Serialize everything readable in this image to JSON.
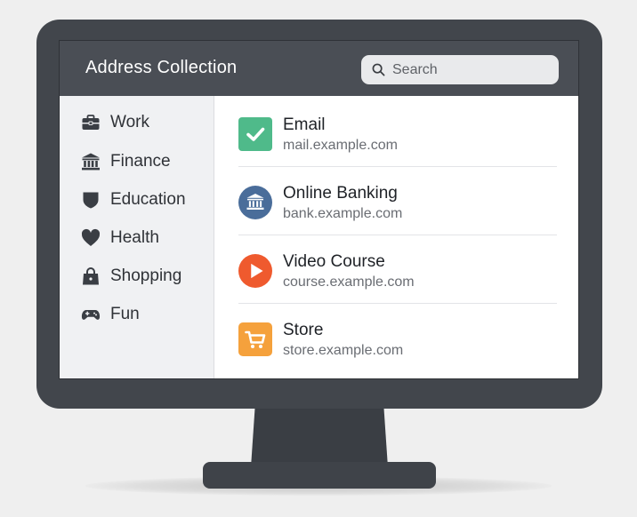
{
  "app": {
    "title": "Address Collection"
  },
  "search": {
    "placeholder": "Search"
  },
  "sidebar": {
    "items": [
      {
        "label": "Work",
        "icon": "briefcase-icon"
      },
      {
        "label": "Finance",
        "icon": "bank-icon"
      },
      {
        "label": "Education",
        "icon": "shield-icon"
      },
      {
        "label": "Health",
        "icon": "heart-icon"
      },
      {
        "label": "Shopping",
        "icon": "shopping-bag-icon"
      },
      {
        "label": "Fun",
        "icon": "gamepad-icon"
      }
    ]
  },
  "addresses": [
    {
      "name": "Email",
      "url": "mail.example.com",
      "icon": "checkmark-icon",
      "color": "#4fba8a"
    },
    {
      "name": "Online Banking",
      "url": "bank.example.com",
      "icon": "bank-icon",
      "color": "#4a6d9a"
    },
    {
      "name": "Video Course",
      "url": "course.example.com",
      "icon": "play-icon",
      "color": "#ef5a2e"
    },
    {
      "name": "Store",
      "url": "store.example.com",
      "icon": "cart-icon",
      "color": "#f5a13c"
    }
  ],
  "colors": {
    "titlebar": "#4a4e55",
    "sidebar": "#f0f1f3",
    "bezel": "#42464c"
  }
}
